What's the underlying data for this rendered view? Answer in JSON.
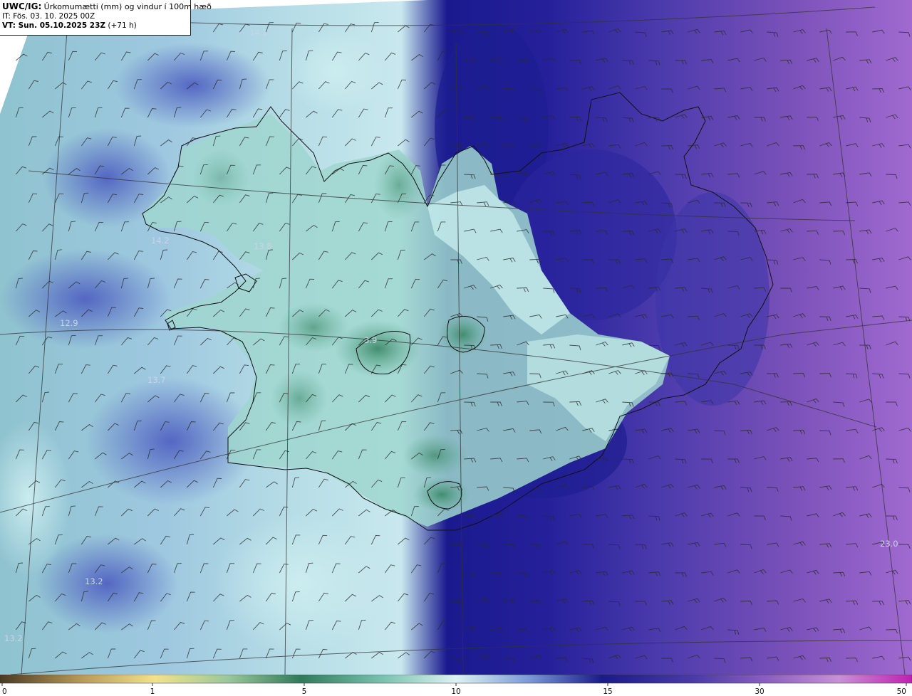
{
  "header": {
    "code": "UWC/IG:",
    "title": "Úrkomumætti (mm) og vindur í 100m hæð",
    "it_line": "IT: Fös. 03. 10. 2025 00Z",
    "vt_label": "VT: Sun. 05.10.2025 23Z",
    "vt_offset": "(+71 h)"
  },
  "map_labels": [
    {
      "name": "label-14-1",
      "text": "14.1"
    },
    {
      "name": "label-14-2",
      "text": "14.2"
    },
    {
      "name": "label-13-8",
      "text": "13.8"
    },
    {
      "name": "label-12-9",
      "text": "12.9"
    },
    {
      "name": "label-13-7",
      "text": "13.7"
    },
    {
      "name": "label-3-9",
      "text": "3.9"
    },
    {
      "name": "label-13-2",
      "text": "13.2"
    },
    {
      "name": "label-13-2b",
      "text": "13.2"
    },
    {
      "name": "label-23-0",
      "text": "23.0"
    }
  ],
  "colorbar": {
    "ticks": [
      "0",
      "1",
      "5",
      "10",
      "15",
      "30",
      "50"
    ],
    "colors": {
      "brown": "#5a4a2a",
      "yellow": "#f0e08a",
      "green": "#2f7a5a",
      "light": "#cfeeee",
      "navy": "#1a1a8a",
      "purple": "#7a4ab0",
      "magenta": "#c020b0"
    }
  },
  "colors": {
    "ocean_west": "#a8cfd8",
    "ocean_east": "#8a5ec0",
    "deep_blue": "#1c1c90",
    "land_green": "#79bca0",
    "coast": "#111111"
  }
}
